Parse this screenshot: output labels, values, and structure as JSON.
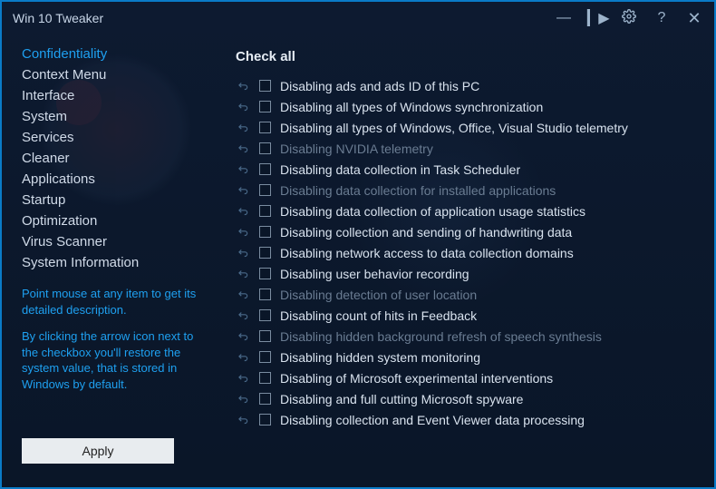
{
  "window": {
    "title": "Win 10 Tweaker"
  },
  "sidebar": {
    "items": [
      {
        "label": "Confidentiality",
        "active": true
      },
      {
        "label": "Context Menu"
      },
      {
        "label": "Interface"
      },
      {
        "label": "System"
      },
      {
        "label": "Services"
      },
      {
        "label": "Cleaner"
      },
      {
        "label": "Applications"
      },
      {
        "label": "Startup"
      },
      {
        "label": "Optimization"
      },
      {
        "label": "Virus Scanner"
      },
      {
        "label": "System Information"
      }
    ],
    "hint1": "Point mouse at any item to get its detailed description.",
    "hint2": "By clicking the arrow icon next to the checkbox you'll restore the system value, that is stored in Windows by default.",
    "apply_label": "Apply"
  },
  "main": {
    "check_all_label": "Check all",
    "tweaks": [
      {
        "label": "Disabling ads and ads ID of this PC",
        "dim": false
      },
      {
        "label": "Disabling all types of Windows synchronization",
        "dim": false
      },
      {
        "label": "Disabling all types of Windows, Office, Visual Studio telemetry",
        "dim": false
      },
      {
        "label": "Disabling NVIDIA telemetry",
        "dim": true
      },
      {
        "label": "Disabling data collection in Task Scheduler",
        "dim": false
      },
      {
        "label": "Disabling data collection for installed applications",
        "dim": true
      },
      {
        "label": "Disabling data collection of application usage statistics",
        "dim": false
      },
      {
        "label": "Disabling collection and sending of handwriting data",
        "dim": false
      },
      {
        "label": "Disabling network access to data collection domains",
        "dim": false
      },
      {
        "label": "Disabling user behavior recording",
        "dim": false
      },
      {
        "label": "Disabling detection of user location",
        "dim": true
      },
      {
        "label": "Disabling count of hits in Feedback",
        "dim": false
      },
      {
        "label": "Disabling hidden background refresh of speech synthesis",
        "dim": true
      },
      {
        "label": "Disabling hidden system monitoring",
        "dim": false
      },
      {
        "label": "Disabling of Microsoft experimental interventions",
        "dim": false
      },
      {
        "label": "Disabling and full cutting Microsoft spyware",
        "dim": false
      },
      {
        "label": "Disabling collection and Event Viewer data processing",
        "dim": false
      }
    ]
  }
}
